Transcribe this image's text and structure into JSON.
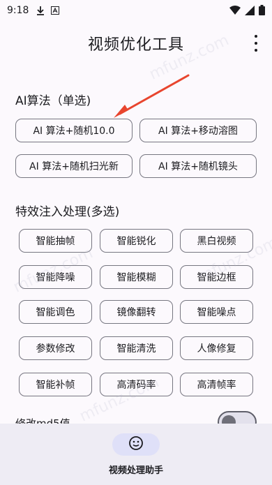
{
  "status_bar": {
    "time": "9:18",
    "icons": [
      "download-icon",
      "font-icon",
      "wifi-icon",
      "signal-icon",
      "battery-icon"
    ]
  },
  "app_bar": {
    "title": "视频优化工具",
    "menu_icon": "more-vert-icon"
  },
  "ai_section": {
    "title": "AI算法（单选)",
    "options": [
      "AI 算法+随机10.0",
      "AI 算法+移动溶图",
      "AI 算法+随机扫光新",
      "AI 算法+随机镜头"
    ]
  },
  "fx_section": {
    "title": "特效注入处理(多选)",
    "options": [
      "智能抽帧",
      "智能锐化",
      "黑白视频",
      "智能降噪",
      "智能模糊",
      "智能边框",
      "智能调色",
      "镜像翻转",
      "智能噪点",
      "参数修改",
      "智能清洗",
      "人像修复",
      "智能补帧",
      "高清码率",
      "高清帧率"
    ]
  },
  "md5": {
    "label": "修改md5值",
    "enabled": false
  },
  "bottom_nav": {
    "label": "视频处理助手",
    "icon": "smiley-face-icon"
  },
  "annotation": {
    "arrow_color": "#e8452e"
  },
  "watermark": "mfunz.com"
}
